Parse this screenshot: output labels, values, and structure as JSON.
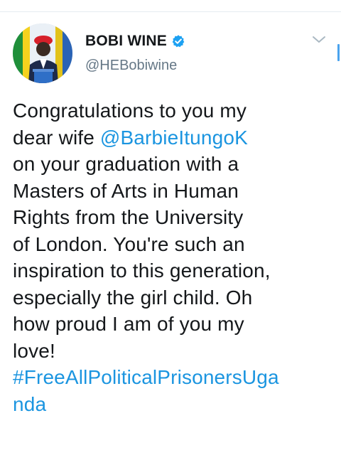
{
  "tweet": {
    "author": {
      "display_name": "BOBI WINE",
      "handle": "@HEBobiwine",
      "verified": true,
      "avatar_icon": "profile-photo-icon"
    },
    "menu_icon": "chevron-down-icon",
    "body_lines": [
      {
        "text": "Congratulations to you my"
      },
      {
        "pre": "dear wife ",
        "mention": "@BarbieItungoK"
      },
      {
        "text": "on your graduation with a"
      },
      {
        "text": "Masters of Arts in Human"
      },
      {
        "text": "Rights from the University"
      },
      {
        "text": "of London. You're such an"
      },
      {
        "text": "inspiration to this generation,"
      },
      {
        "text": "especially the girl child. Oh"
      },
      {
        "text": "how proud I am of you my"
      },
      {
        "text": "love!"
      },
      {
        "hashtag_part1": "#FreeAllPoliticalPrisonersUga"
      },
      {
        "hashtag_part2": "nda"
      }
    ],
    "colors": {
      "text": "#14171a",
      "link": "#1b95e0",
      "secondary": "#657786",
      "verified": "#1da1f2"
    }
  }
}
